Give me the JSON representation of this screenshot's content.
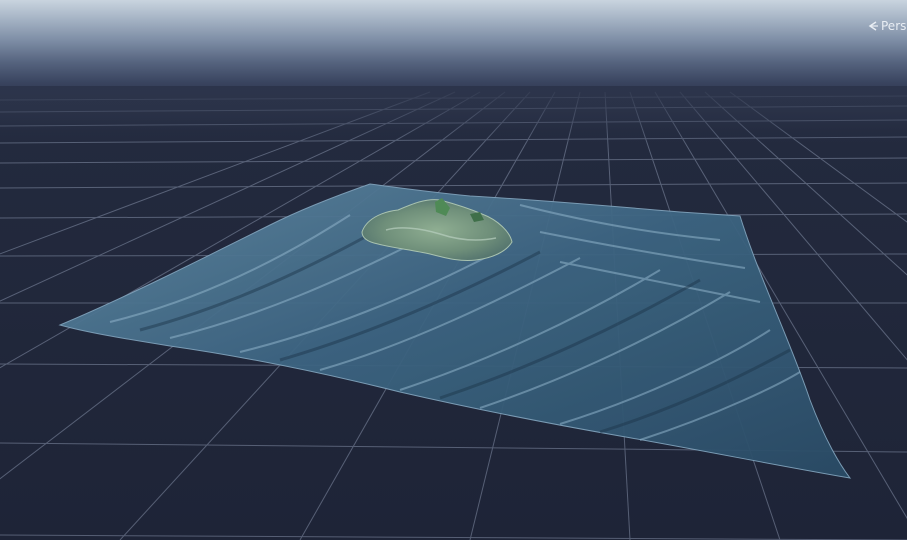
{
  "scene_view": {
    "projection_label": "Persp",
    "projection_icon": "chevron-left-icon"
  },
  "colors": {
    "sky_top": "#c9d4df",
    "ground": "#1e2437",
    "grid_line": "#9aa6bf",
    "water_deep": "#1f3d56",
    "water_light": "#5f8aa6",
    "island": "#6f8f7a"
  }
}
